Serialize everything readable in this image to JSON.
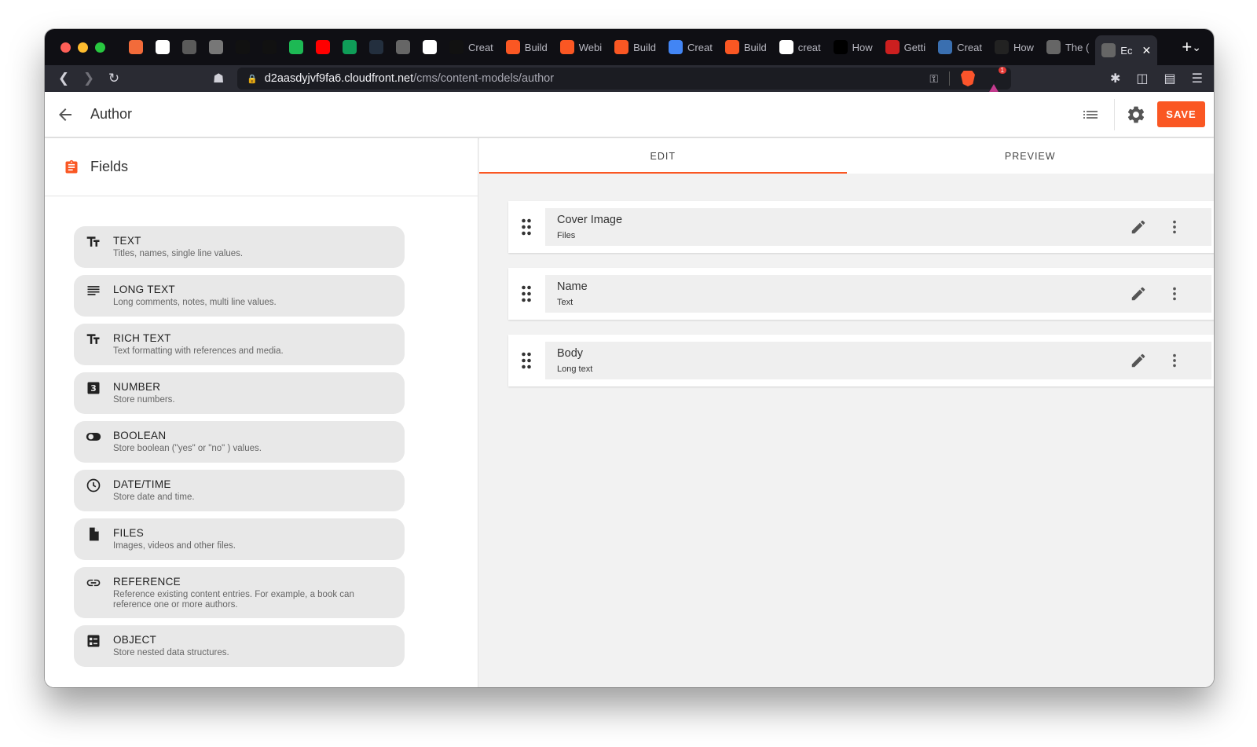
{
  "browser": {
    "tabs": [
      {
        "label": "",
        "icon": "swirl-icon",
        "color": "#f26b3a"
      },
      {
        "label": "",
        "icon": "checkmark-icon",
        "color": "#ffffff"
      },
      {
        "label": "",
        "icon": "s-icon",
        "color": "#5a5a5a"
      },
      {
        "label": "",
        "icon": "apple-icon",
        "color": "#777777"
      },
      {
        "label": "",
        "icon": "github-icon",
        "color": "#111111"
      },
      {
        "label": "",
        "icon": "github-icon",
        "color": "#111111"
      },
      {
        "label": "",
        "icon": "spotify-icon",
        "color": "#1db954"
      },
      {
        "label": "",
        "icon": "youtube-icon",
        "color": "#ff0000"
      },
      {
        "label": "",
        "icon": "sheets-icon",
        "color": "#0f9d58"
      },
      {
        "label": "",
        "icon": "aws-icon",
        "color": "#232f3e"
      },
      {
        "label": "",
        "icon": "globe-icon",
        "color": "#666666"
      },
      {
        "label": "",
        "icon": "notion-icon",
        "color": "#ffffff"
      },
      {
        "label": "Creat",
        "icon": "github-icon",
        "color": "#111111"
      },
      {
        "label": "Build",
        "icon": "webiny-icon",
        "color": "#fa5723"
      },
      {
        "label": "Webi",
        "icon": "webiny-icon",
        "color": "#fa5723"
      },
      {
        "label": "Build",
        "icon": "webiny-icon",
        "color": "#fa5723"
      },
      {
        "label": "Creat",
        "icon": "docs-icon",
        "color": "#4285f4"
      },
      {
        "label": "Build",
        "icon": "webiny-icon",
        "color": "#fa5723"
      },
      {
        "label": "creat",
        "icon": "google-icon",
        "color": "#ffffff"
      },
      {
        "label": "How",
        "icon": "medium-icon",
        "color": "#000000"
      },
      {
        "label": "Getti",
        "icon": "hlt-icon",
        "color": "#cc1f1f"
      },
      {
        "label": "Creat",
        "icon": "person-icon",
        "color": "#3a6fb0"
      },
      {
        "label": "How",
        "icon": "a-icon",
        "color": "#222222"
      },
      {
        "label": "The (",
        "icon": "globe-icon",
        "color": "#666666"
      },
      {
        "label": "Ec",
        "icon": "globe-icon",
        "color": "#666666",
        "active": true
      }
    ],
    "new_tab": "+",
    "url_host": "d2aasdyjvf9fa6.cloudfront.net",
    "url_path": "/cms/content-models/author",
    "notification_count": "1"
  },
  "app": {
    "title": "Author",
    "save_label": "SAVE",
    "accent": "#fa5723"
  },
  "left": {
    "header": "Fields",
    "field_types": [
      {
        "name": "TEXT",
        "desc": "Titles, names, single line values.",
        "icon": "text-type-icon"
      },
      {
        "name": "LONG TEXT",
        "desc": "Long comments, notes, multi line values.",
        "icon": "lines-icon"
      },
      {
        "name": "RICH TEXT",
        "desc": "Text formatting with references and media.",
        "icon": "text-type-icon"
      },
      {
        "name": "NUMBER",
        "desc": "Store numbers.",
        "icon": "number-three-icon"
      },
      {
        "name": "BOOLEAN",
        "desc": "Store boolean (\"yes\" or \"no\" ) values.",
        "icon": "toggle-icon"
      },
      {
        "name": "DATE/TIME",
        "desc": "Store date and time.",
        "icon": "clock-icon"
      },
      {
        "name": "FILES",
        "desc": "Images, videos and other files.",
        "icon": "file-icon"
      },
      {
        "name": "REFERENCE",
        "desc": "Reference existing content entries. For example, a book can reference one or more authors.",
        "icon": "link-icon"
      },
      {
        "name": "OBJECT",
        "desc": "Store nested data structures.",
        "icon": "object-icon"
      }
    ]
  },
  "right": {
    "tabs": [
      {
        "label": "EDIT",
        "active": true
      },
      {
        "label": "PREVIEW",
        "active": false
      }
    ],
    "fields": [
      {
        "name": "Cover Image",
        "type": "Files"
      },
      {
        "name": "Name",
        "type": "Text"
      },
      {
        "name": "Body",
        "type": "Long text"
      }
    ]
  }
}
